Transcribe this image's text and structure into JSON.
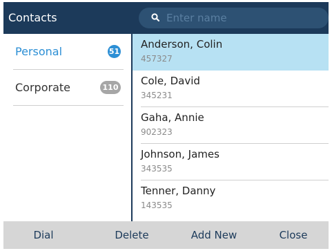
{
  "header": {
    "title": "Contacts",
    "search": {
      "placeholder": "Enter name",
      "value": ""
    }
  },
  "sidebar": {
    "items": [
      {
        "label": "Personal",
        "count": "51",
        "active": true
      },
      {
        "label": "Corporate",
        "count": "110",
        "active": false
      }
    ]
  },
  "contacts": [
    {
      "name": "Anderson, Colin",
      "number": "457327",
      "selected": true
    },
    {
      "name": "Cole, David",
      "number": "345231",
      "selected": false
    },
    {
      "name": "Gaha, Annie",
      "number": "902323",
      "selected": false
    },
    {
      "name": "Johnson, James",
      "number": "343535",
      "selected": false
    },
    {
      "name": "Tenner, Danny",
      "number": "143535",
      "selected": false
    }
  ],
  "softkeys": {
    "dial": "Dial",
    "delete": "Delete",
    "add_new": "Add New",
    "close": "Close"
  },
  "colors": {
    "header_bg": "#1c3a5a",
    "accent": "#2c8fd5",
    "selected_row": "#b7e1f3",
    "softkey_bar": "#d6d6d6"
  }
}
